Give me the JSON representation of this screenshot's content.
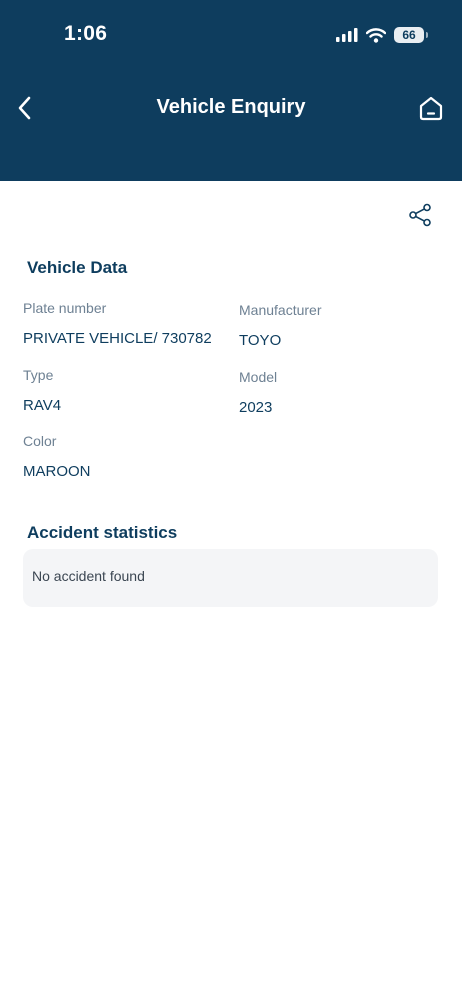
{
  "status_bar": {
    "time": "1:06",
    "battery": "66"
  },
  "nav": {
    "title": "Vehicle Enquiry"
  },
  "vehicle_section": {
    "title": "Vehicle Data",
    "fields": {
      "plate_label": "Plate number",
      "plate_value": "PRIVATE VEHICLE/ 730782",
      "manufacturer_label": "Manufacturer",
      "manufacturer_value": "TOYO",
      "type_label": "Type",
      "type_value": "RAV4",
      "model_label": "Model",
      "model_value": "2023",
      "color_label": "Color",
      "color_value": "MAROON"
    }
  },
  "accident_section": {
    "title": "Accident statistics",
    "message": "No accident found"
  },
  "colors": {
    "header": "#0e3d5e",
    "text_primary": "#0e3d5e",
    "label": "#6e8193",
    "card": "#f4f5f7"
  },
  "icons": [
    "back-chevron-icon",
    "home-icon",
    "share-icon",
    "signal-icon",
    "wifi-icon",
    "battery-icon"
  ]
}
